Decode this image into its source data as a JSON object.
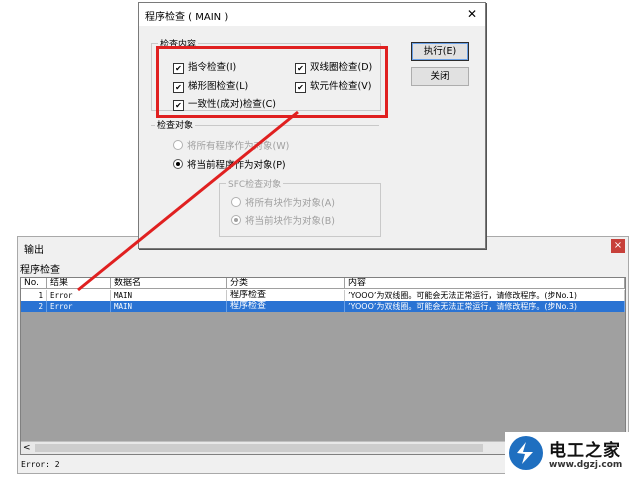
{
  "output": {
    "title": "输出",
    "close_label": "×",
    "tab_label": "程序检查",
    "columns": [
      "No.",
      "结果",
      "数据名",
      "分类",
      "内容"
    ],
    "rows": [
      {
        "no": "1",
        "result": "Error",
        "data_name": "MAIN",
        "category": "程序检查",
        "content": "’YOOO’为双线圈。可能会无法正常运行，请修改程序。(步No.1)",
        "selected": false
      },
      {
        "no": "2",
        "result": "Error",
        "data_name": "MAIN",
        "category": "程序检查",
        "content": "’YOOO’为双线圈。可能会无法正常运行，请修改程序。(步No.3)",
        "selected": true
      }
    ],
    "scroll_left": "<",
    "status": "Error: 2"
  },
  "dialog": {
    "title": "程序检查 ( MAIN )",
    "close_label": "✕",
    "check_group_label": "检查内容",
    "checks": [
      {
        "label": "指令检查(I)",
        "checked": true
      },
      {
        "label": "双线圈检查(D)",
        "checked": true
      },
      {
        "label": "梯形图检查(L)",
        "checked": true
      },
      {
        "label": "软元件检查(V)",
        "checked": true
      },
      {
        "label": "一致性(成对)检查(C)",
        "checked": true
      }
    ],
    "target_group_label": "检查对象",
    "targets": [
      {
        "label": "将所有程序作为对象(W)",
        "selected": false,
        "disabled": true
      },
      {
        "label": "将当前程序作为对象(P)",
        "selected": true,
        "disabled": false
      }
    ],
    "sfc_group_label": "SFC检查对象",
    "sfc_targets": [
      {
        "label": "将所有块作为对象(A)",
        "selected": false
      },
      {
        "label": "将当前块作为对象(B)",
        "selected": true
      }
    ],
    "execute_label": "执行(E)",
    "close_button_label": "关闭"
  },
  "logo": {
    "text": "电工之家",
    "url": "www.dgzj.com"
  },
  "colors": {
    "highlight": "#e02020",
    "selection": "#2a73d3"
  }
}
